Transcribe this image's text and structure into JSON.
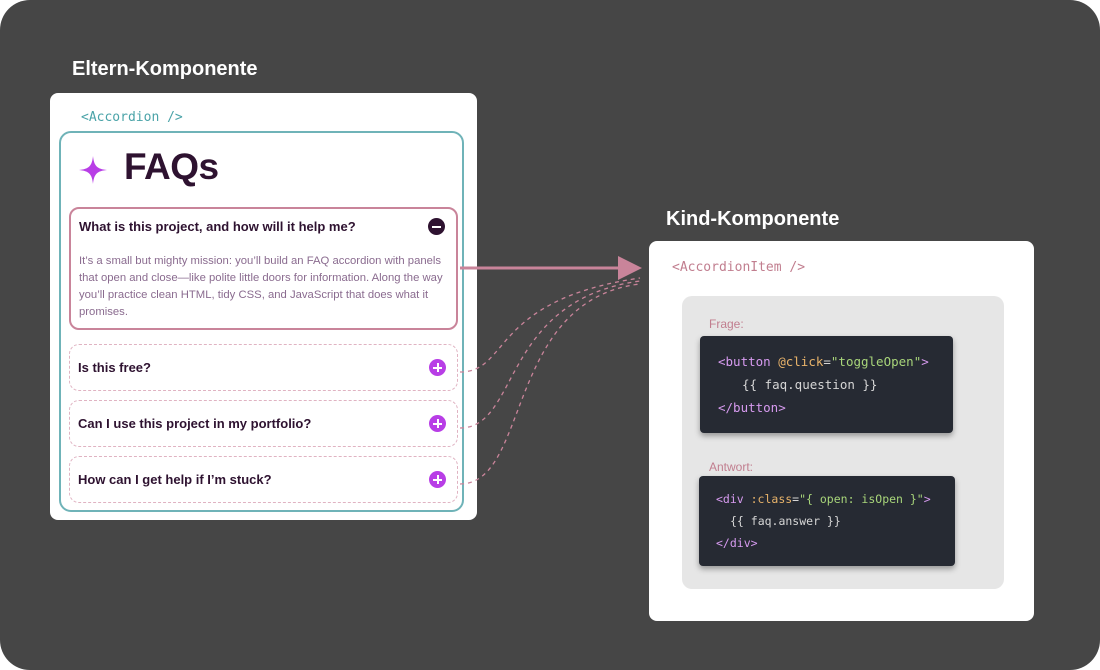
{
  "headings": {
    "parent": "Eltern-Komponente",
    "child": "Kind-Komponente"
  },
  "parent_card": {
    "tag": "<Accordion />",
    "title": "FAQs",
    "items": [
      {
        "question": "What is this project, and how will it help me?",
        "answer": "It’s a small but mighty mission: you’ll build an FAQ accordion with panels that open and close—like polite little doors for information. Along the way you’ll practice clean HTML, tidy CSS, and JavaScript that does what it promises.",
        "state": "open"
      },
      {
        "question": "Is this free?",
        "state": "closed"
      },
      {
        "question": "Can I use this project in my portfolio?",
        "state": "closed"
      },
      {
        "question": "How can I get help if I’m stuck?",
        "state": "closed"
      }
    ]
  },
  "child_card": {
    "tag": "<AccordionItem />",
    "question_label": "Frage:",
    "answer_label": "Antwort:",
    "question_code": {
      "l1": {
        "open": "<button",
        "attr": " @click",
        "eq": "=",
        "value": "\"toggleOpen\"",
        "close": ">"
      },
      "l2": "{{ faq.question }}",
      "l3": "</button>"
    },
    "answer_code": {
      "l1": {
        "open": "<div",
        "attr": " :class",
        "eq": "=",
        "value": "\"{ open: isOpen }\"",
        "close": ">"
      },
      "l2": "{{ faq.answer }}",
      "l3": "</div>"
    }
  },
  "colors": {
    "background": "#464646",
    "teal_accent": "#6fb3b8",
    "pink_accent": "#c9849a",
    "purple_icon": "#b83ee6",
    "dark_text": "#2e1230",
    "code_bg": "#262a33"
  },
  "icons": {
    "title_icon": "sparkle-icon",
    "open_toggle": "minus-circle-icon",
    "closed_toggle": "plus-circle-icon"
  }
}
